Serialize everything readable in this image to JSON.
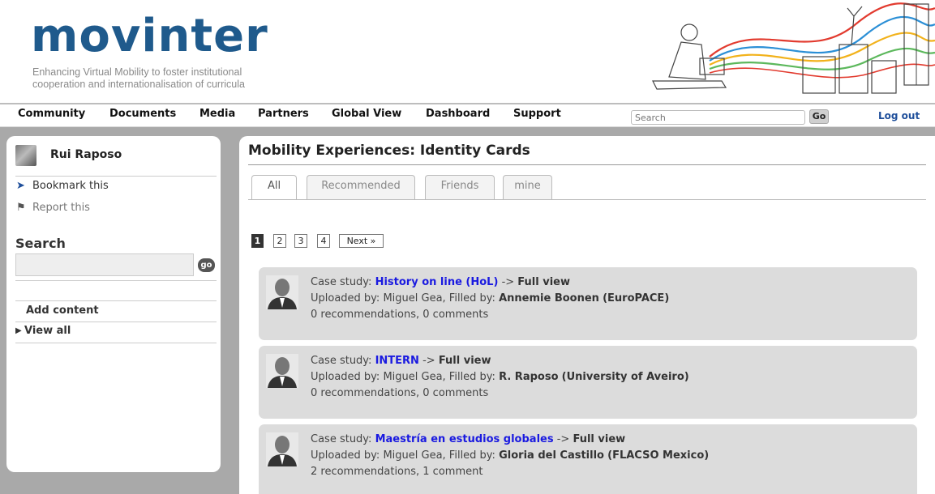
{
  "header": {
    "logo_text": "movinter",
    "tagline_line1": "Enhancing Virtual Mobility to foster institutional",
    "tagline_line2": "cooperation and internationalisation of curricula"
  },
  "nav": {
    "items": [
      "Community",
      "Documents",
      "Media",
      "Partners",
      "Global View",
      "Dashboard",
      "Support"
    ],
    "search_placeholder": "Search",
    "go_label": "Go",
    "logout_label": "Log out"
  },
  "sidebar": {
    "user_name": "Rui Raposo",
    "bookmark_label": "Bookmark this",
    "report_label": "Report this",
    "search_title": "Search",
    "search_go_label": "go",
    "add_content_label": "Add content",
    "view_all_label": "View all"
  },
  "main": {
    "title": "Mobility Experiences: Identity Cards",
    "tabs": [
      "All",
      "Recommended",
      "Friends",
      "mine"
    ],
    "active_tab": "All",
    "pagination": {
      "pages": [
        "1",
        "2",
        "3",
        "4"
      ],
      "current": "1",
      "next_label": "Next »"
    },
    "cards": [
      {
        "prefix": "Case study:",
        "title": "History on line (HoL)",
        "arrow": "->",
        "full_view_label": "Full view",
        "uploaded_prefix": "Uploaded by: Miguel Gea, Filled by:",
        "filled_by": "Annemie Boonen",
        "institution": "(EuroPACE)",
        "stats": "0 recommendations, 0 comments"
      },
      {
        "prefix": "Case study:",
        "title": "INTERN",
        "arrow": "->",
        "full_view_label": "Full view",
        "uploaded_prefix": "Uploaded by: Miguel Gea, Filled by:",
        "filled_by": "R. Raposo",
        "institution": "(University of Aveiro)",
        "stats": "0 recommendations, 0 comments"
      },
      {
        "prefix": "Case study:",
        "title": "Maestría en estudios globales",
        "arrow": "->",
        "full_view_label": "Full view",
        "uploaded_prefix": "Uploaded by: Miguel Gea, Filled by:",
        "filled_by": "Gloria del Castillo",
        "institution": "(FLACSO Mexico)",
        "stats": "2 recommendations, 1 comment"
      }
    ]
  },
  "colors": {
    "logo_blue": "#1f5a8c",
    "link_blue": "#1a1ae0",
    "card_bg": "#dcdcdc",
    "page_bg": "#a9a9a9"
  }
}
